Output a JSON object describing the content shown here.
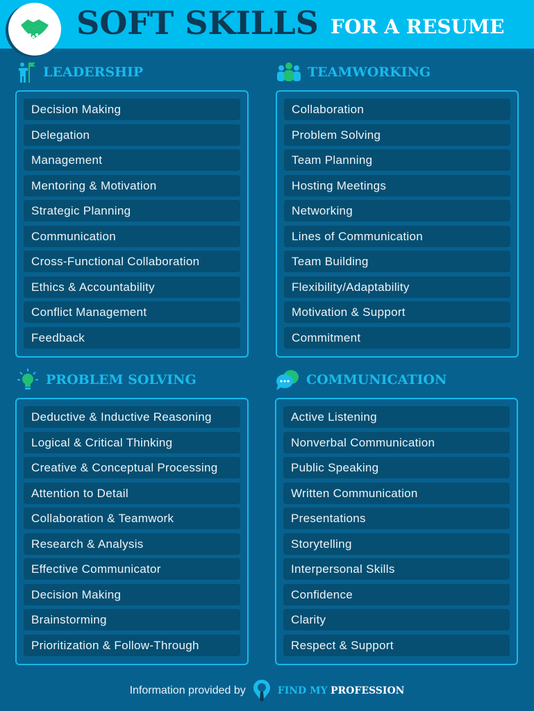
{
  "header": {
    "title_main": "SOFT SKILLS",
    "title_sub": "FOR A RESUME",
    "logo_icon": "handshake-icon"
  },
  "colors": {
    "background": "#07618f",
    "header_band": "#00bdf0",
    "title_dark": "#0d3a55",
    "accent_cyan": "#18bbeb",
    "accent_green": "#1fbf75",
    "item_bg": "#064f72"
  },
  "sections": [
    {
      "title": "LEADERSHIP",
      "icon": "person-flag-icon",
      "items": [
        "Decision Making",
        "Delegation",
        "Management",
        "Mentoring & Motivation",
        "Strategic Planning",
        "Communication",
        "Cross-Functional Collaboration",
        "Ethics & Accountability",
        "Conflict Management",
        "Feedback"
      ]
    },
    {
      "title": "TEAMWORKING",
      "icon": "team-icon",
      "items": [
        "Collaboration",
        "Problem Solving",
        "Team Planning",
        "Hosting Meetings",
        "Networking",
        "Lines of Communication",
        "Team Building",
        "Flexibility/Adaptability",
        "Motivation & Support",
        "Commitment"
      ]
    },
    {
      "title": "PROBLEM SOLVING",
      "icon": "lightbulb-icon",
      "items": [
        "Deductive & Inductive Reasoning",
        "Logical & Critical Thinking",
        "Creative & Conceptual Processing",
        "Attention to Detail",
        "Collaboration & Teamwork",
        "Research & Analysis",
        "Effective Communicator",
        "Decision Making",
        "Brainstorming",
        "Prioritization & Follow-Through"
      ]
    },
    {
      "title": "COMMUNICATION",
      "icon": "chat-bubbles-icon",
      "items": [
        "Active Listening",
        "Nonverbal Communication",
        "Public Speaking",
        "Written Communication",
        "Presentations",
        "Storytelling",
        "Interpersonal Skills",
        "Confidence",
        "Clarity",
        "Respect & Support"
      ]
    }
  ],
  "footer": {
    "text": "Information provided by",
    "brand_part1": "FIND MY",
    "brand_part2": "PROFESSION",
    "brand_icon": "location-pin-tie-icon"
  }
}
